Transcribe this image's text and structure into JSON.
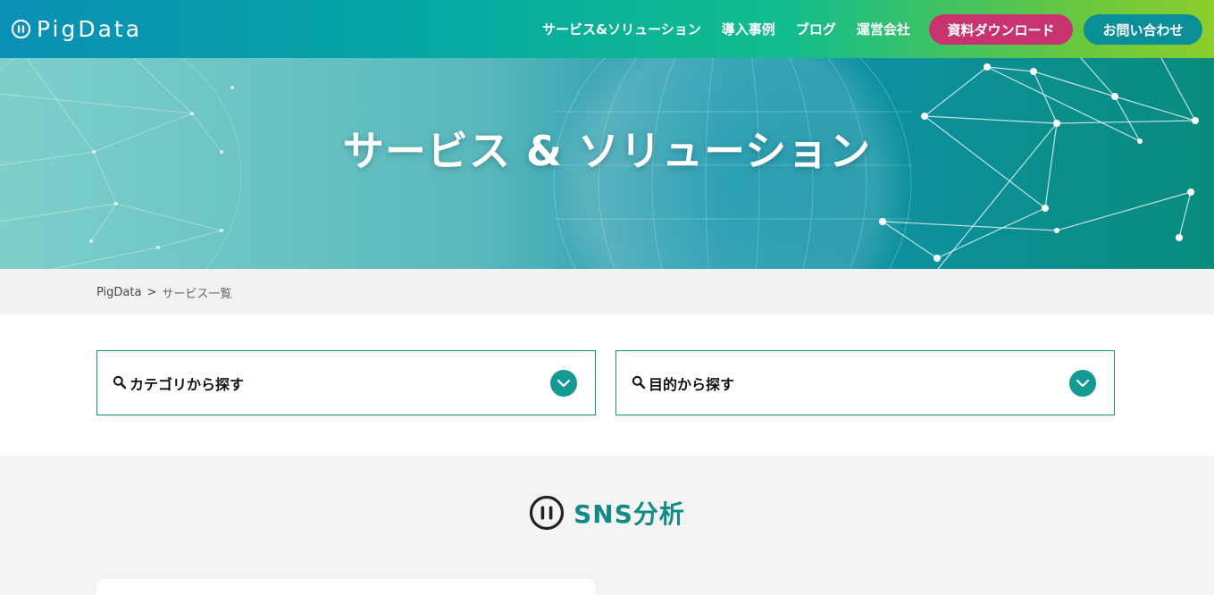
{
  "header": {
    "logo_text": "PigData",
    "nav": [
      {
        "label": "サービス&ソリューション"
      },
      {
        "label": "導入事例"
      },
      {
        "label": "ブログ"
      },
      {
        "label": "運営会社"
      }
    ],
    "download_label": "資料ダウンロード",
    "contact_label": "お問い合わせ",
    "colors": {
      "download": "#c8336f",
      "contact": "#0a8f99"
    }
  },
  "hero": {
    "title": "サービス & ソリューション"
  },
  "breadcrumb": {
    "home": "PigData",
    "separator": ">",
    "current": "サービス一覧"
  },
  "filters": {
    "category_label": "カテゴリから探す",
    "purpose_label": "目的から探す",
    "icon": "search-icon",
    "toggle_icon": "chevron-down-icon"
  },
  "section": {
    "title": "SNS分析",
    "icon": "pigdata-mark-icon",
    "accent": "#138a87"
  }
}
